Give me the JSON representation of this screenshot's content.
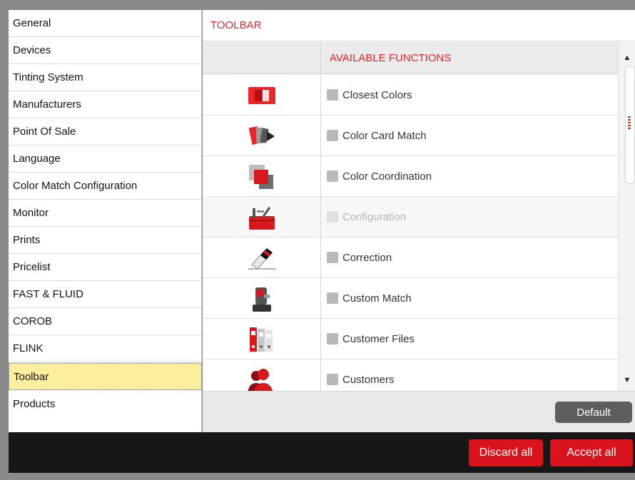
{
  "sidebar": {
    "items": [
      {
        "label": "General"
      },
      {
        "label": "Devices"
      },
      {
        "label": "Tinting System"
      },
      {
        "label": "Manufacturers"
      },
      {
        "label": "Point Of Sale"
      },
      {
        "label": "Language"
      },
      {
        "label": "Color Match Configuration"
      },
      {
        "label": "Monitor"
      },
      {
        "label": "Prints"
      },
      {
        "label": "Pricelist"
      },
      {
        "label": "FAST & FLUID"
      },
      {
        "label": "COROB"
      },
      {
        "label": "FLINK"
      },
      {
        "label": "Toolbar",
        "active": true
      },
      {
        "label": "Products"
      }
    ]
  },
  "main": {
    "title": "TOOLBAR",
    "column_header": "AVAILABLE FUNCTIONS",
    "rows": [
      {
        "label": "Closest Colors",
        "icon": "closest-colors-icon",
        "enabled": true
      },
      {
        "label": "Color Card Match",
        "icon": "color-card-match-icon",
        "enabled": true
      },
      {
        "label": "Color Coordination",
        "icon": "color-coordination-icon",
        "enabled": true
      },
      {
        "label": "Configuration",
        "icon": "toolbox-icon",
        "enabled": false
      },
      {
        "label": "Correction",
        "icon": "eraser-icon",
        "enabled": true
      },
      {
        "label": "Custom Match",
        "icon": "spectrophotometer-icon",
        "enabled": true
      },
      {
        "label": "Customer Files",
        "icon": "binders-icon",
        "enabled": true
      },
      {
        "label": "Customers",
        "icon": "customers-icon",
        "enabled": true
      }
    ],
    "default_button": "Default"
  },
  "footer": {
    "discard_label": "Discard all",
    "accept_label": "Accept all"
  },
  "colors": {
    "accent_red": "#d8262c",
    "button_red": "#d8131c",
    "active_highlight": "#fbef9e",
    "footer_bg": "#171717"
  }
}
